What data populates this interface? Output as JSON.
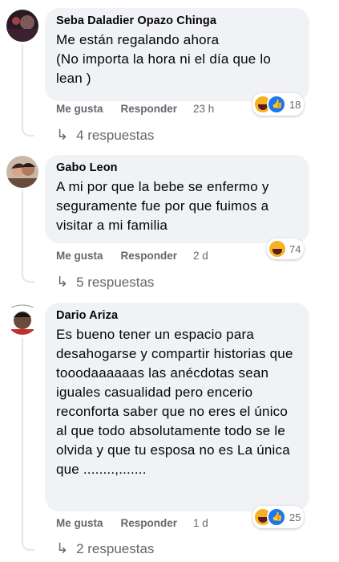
{
  "comments": [
    {
      "author": "Seba Daladier Opazo Chinga",
      "text": "Me están regalando ahora\n(No importa la hora ni el día que lo lean )",
      "like_label": "Me gusta",
      "reply_label": "Responder",
      "time": "23 h",
      "reactions": [
        "haha",
        "like"
      ],
      "reaction_count": "18",
      "replies_label": "4 respuestas"
    },
    {
      "author": "Gabo Leon",
      "text": "A mi por que la bebe se enfermo y seguramente fue por que fuimos a visitar a mi familia",
      "like_label": "Me gusta",
      "reply_label": "Responder",
      "time": "2 d",
      "reactions": [
        "haha"
      ],
      "reaction_count": "74",
      "replies_label": "5 respuestas"
    },
    {
      "author": "Dario Ariza",
      "text": "Es bueno tener un espacio para desahogarse y compartir historias que tooodaaaaaas las anécdotas sean iguales casualidad pero encerio reconforta saber que no eres el único al que todo absolutamente todo se le olvida y que tu esposa no es La única que ........,.......",
      "like_label": "Me gusta",
      "reply_label": "Responder",
      "time": "1 d",
      "reactions": [
        "haha",
        "like"
      ],
      "reaction_count": "25",
      "replies_label": "2 respuestas"
    }
  ],
  "colors": {
    "bubble_bg": "#f0f2f5",
    "secondary_text": "#65676b",
    "like_blue": "#1877f2",
    "haha_yellow": "#f7b125"
  }
}
